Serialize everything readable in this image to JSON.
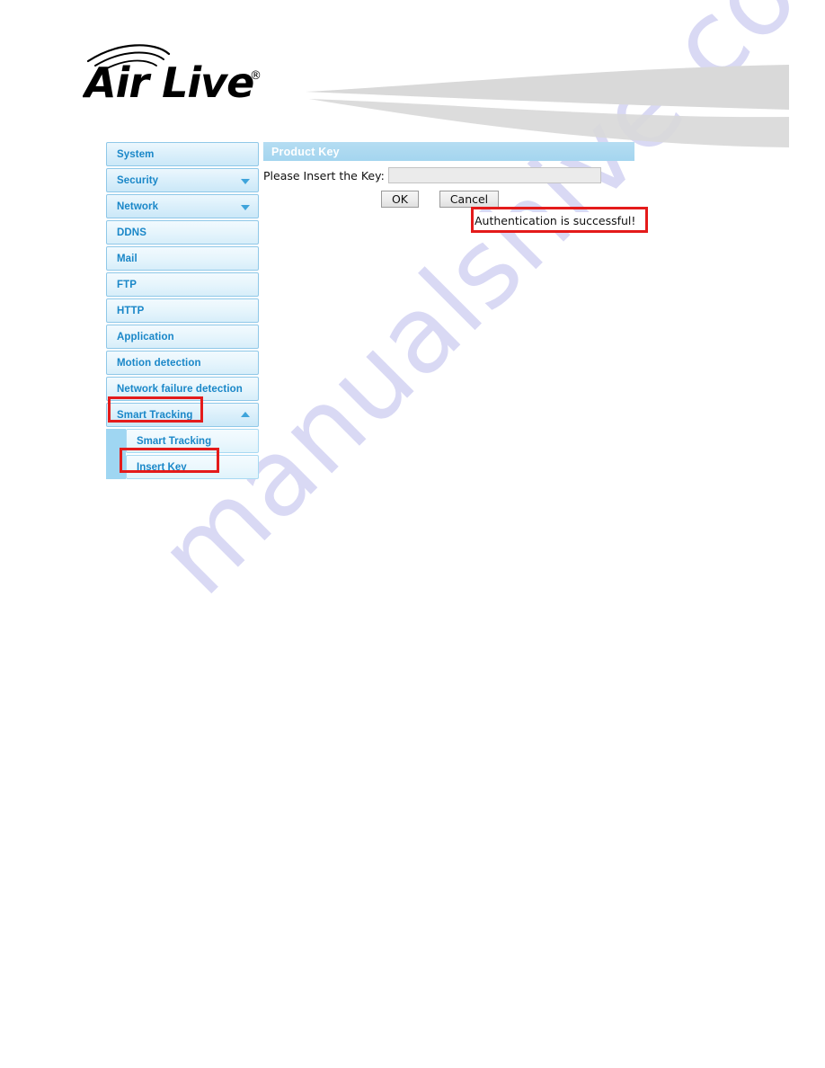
{
  "brand": {
    "logo_text": "AirLive",
    "logo_mark": "registered-trademark",
    "banner_graphic": "gray-swoosh"
  },
  "sidebar": {
    "items": [
      {
        "label": "System",
        "expandable": false,
        "caret": ""
      },
      {
        "label": "Security",
        "expandable": true,
        "caret": "chevron-down-icon"
      },
      {
        "label": "Network",
        "expandable": true,
        "caret": "chevron-down-icon"
      },
      {
        "label": "DDNS",
        "expandable": false,
        "caret": ""
      },
      {
        "label": "Mail",
        "expandable": false,
        "caret": ""
      },
      {
        "label": "FTP",
        "expandable": false,
        "caret": ""
      },
      {
        "label": "HTTP",
        "expandable": false,
        "caret": ""
      },
      {
        "label": "Application",
        "expandable": false,
        "caret": ""
      },
      {
        "label": "Motion detection",
        "expandable": false,
        "caret": ""
      },
      {
        "label": "Network failure detection",
        "expandable": false,
        "caret": ""
      },
      {
        "label": "Smart Tracking",
        "expandable": true,
        "caret": "chevron-up-icon",
        "expanded": true
      }
    ],
    "subitems": [
      {
        "label": "Smart Tracking"
      },
      {
        "label": "Insert Key"
      }
    ]
  },
  "main": {
    "panel_title": "Product Key",
    "key_label": "Please Insert the Key:",
    "key_value": "",
    "key_placeholder": "",
    "ok_label": "OK",
    "cancel_label": "Cancel",
    "status_message": "Authentication is successful!"
  },
  "annotations": {
    "highlight_color": "#e41b1b",
    "boxes": [
      {
        "target": "Smart Tracking"
      },
      {
        "target": "Insert Key"
      },
      {
        "target": "Authentication is successful!"
      }
    ]
  },
  "watermark": {
    "text": "manualshive.com",
    "color": "#d9d9f4"
  }
}
